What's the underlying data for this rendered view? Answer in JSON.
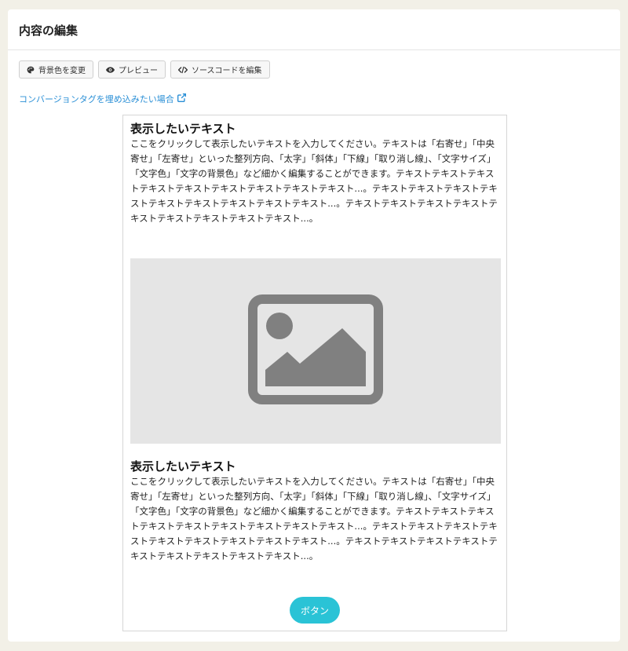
{
  "header": {
    "title": "内容の編集"
  },
  "toolbar": {
    "background_label": "背景色を変更",
    "preview_label": "プレビュー",
    "source_label": "ソースコードを編集"
  },
  "conversion_link": {
    "label": "コンバージョンタグを埋め込みたい場合"
  },
  "content": {
    "block1": {
      "heading": "表示したいテキスト",
      "body": "ここをクリックして表示したいテキストを入力してください。テキストは「右寄せ」「中央寄せ」「左寄せ」といった整列方向、「太字」「斜体」「下線」「取り消し線」、「文字サイズ」「文字色」「文字の背景色」など細かく編集することができます。テキストテキストテキストテキストテキストテキストテキストテキストテキスト...。テキストテキストテキストテキストテキストテキストテキストテキストテキスト...。テキストテキストテキストテキストテキストテキストテキストテキストテキスト...。"
    },
    "image": {
      "icon": "image-placeholder-icon"
    },
    "block2": {
      "heading": "表示したいテキスト",
      "body": "ここをクリックして表示したいテキストを入力してください。テキストは「右寄せ」「中央寄せ」「左寄せ」といった整列方向、「太字」「斜体」「下線」「取り消し線」、「文字サイズ」「文字色」「文字の背景色」など細かく編集することができます。テキストテキストテキストテキストテキストテキストテキストテキストテキスト...。テキストテキストテキストテキストテキストテキストテキストテキストテキスト...。テキストテキストテキストテキストテキストテキストテキストテキストテキスト...。"
    },
    "button": {
      "label": "ボタン"
    }
  },
  "colors": {
    "accent": "#2ac3d6",
    "link": "#2a8fd6",
    "page_bg": "#f2f0e7"
  }
}
